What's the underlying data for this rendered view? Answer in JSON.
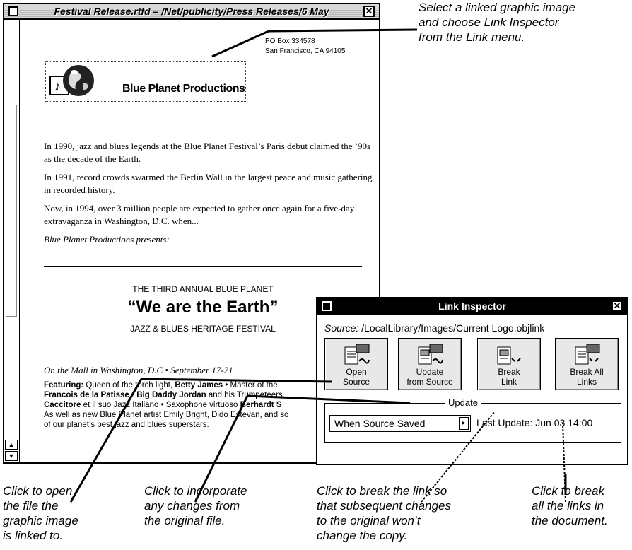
{
  "doc_window": {
    "title": "Festival Release.rtfd  –  /Net/publicity/Press Releases/6 May",
    "address_line1": "PO Box 334578",
    "address_line2": "San Francisco, CA 94105",
    "logo_text": "Blue Planet Productions",
    "para1": "In 1990, jazz and blues legends at the Blue Planet Festival’s Paris debut claimed the ’90s as the decade of the Earth.",
    "para2": "In 1991, record crowds swarmed the Berlin Wall in the largest peace and music gathering in recorded history.",
    "para3": "Now, in 1994, over 3 million people are expected to gather once again for a five-day extravaganza in Washington, D.C. when...",
    "presents": "Blue Planet Productions presents:",
    "annual": "THE THIRD ANNUAL  BLUE PLANET",
    "big_title": "“We are the Earth”",
    "festival": "JAZZ & BLUES HERITAGE FESTIVAL",
    "mall": "On the Mall in Washington, D.C  •  September 17-21",
    "featuring": {
      "label": "Featuring:",
      "t1": " Queen of the torch light, ",
      "n1": "Betty James",
      "t2": "  •  Master of the",
      "n2": "Francois de la Patisse",
      "t3": "  •  ",
      "n3": "Big Daddy Jordan",
      "t4": " and his Trumpeteers",
      "n4": "Caccitore",
      "t5": " et il suo Jazz Italiano  •  Saxophone virtuoso ",
      "n5": "Berhardt S",
      "line4": "As well as new Blue Planet artist Emily Bright, Dido Estevan, and so",
      "line5": "of our planet’s best jazz and blues superstars."
    }
  },
  "link_inspector": {
    "title": "Link Inspector",
    "source_label": "Source:",
    "source_path": " /LocalLibrary/Images/Current Logo.objlink",
    "buttons": [
      {
        "line1": "Open",
        "line2": "Source"
      },
      {
        "line1": "Update",
        "line2": "from Source"
      },
      {
        "line1": "Break",
        "line2": "Link"
      },
      {
        "line1": "Break All",
        "line2": "Links"
      }
    ],
    "update_group_label": "Update",
    "update_mode": "When Source Saved",
    "last_update": "Last Update: Jun 03 14:00"
  },
  "annotations": {
    "select": [
      "Select a linked graphic image",
      "and choose Link Inspector",
      "from the Link menu."
    ],
    "open": [
      "Click to open",
      "the file the",
      "graphic image",
      "is linked to."
    ],
    "update": [
      "Click to incorporate",
      "any changes from",
      "the original file."
    ],
    "break": [
      "Click to break the link so",
      "that subsequent changes",
      "to the original won’t",
      "change the copy."
    ],
    "break_all": [
      "Click to break",
      "all the links in",
      "the document."
    ]
  },
  "icons": {
    "close": "close-icon",
    "miniaturize": "miniaturize-icon",
    "scroll_up": "scroll-up-arrow-icon",
    "scroll_down": "scroll-down-arrow-icon",
    "globe": "globe-logo-icon",
    "document_link": "linked-document-icon"
  }
}
